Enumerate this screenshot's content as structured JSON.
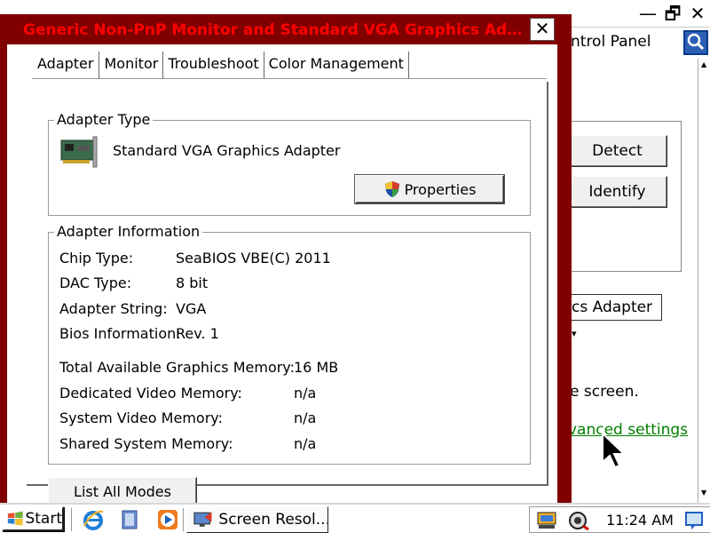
{
  "background_window": {
    "title_buttons": {
      "minimize": "—",
      "restore": "🗗",
      "close": "✕"
    },
    "control_panel_label": "ntrol Panel",
    "detect_button": "Detect",
    "identify_button": "Identify",
    "display_dropdown": "cs Adapter",
    "screen_text": "e screen.",
    "advanced_settings_link": "vanced settings"
  },
  "dialog": {
    "title": "Generic Non-PnP Monitor and Standard VGA Graphics Adapter Pro...",
    "close_label": "✕",
    "tabs": [
      {
        "label": "Adapter",
        "active": true
      },
      {
        "label": "Monitor",
        "active": false
      },
      {
        "label": "Troubleshoot",
        "active": false
      },
      {
        "label": "Color Management",
        "active": false
      }
    ],
    "adapter_type": {
      "legend": "Adapter Type",
      "name": "Standard VGA Graphics Adapter",
      "properties_button": "Properties"
    },
    "adapter_information": {
      "legend": "Adapter Information",
      "rows": [
        {
          "label": "Chip Type:",
          "value": "SeaBIOS VBE(C) 2011"
        },
        {
          "label": "DAC Type:",
          "value": "8 bit"
        },
        {
          "label": "Adapter String:",
          "value": "VGA"
        },
        {
          "label": "Bios Information:",
          "value": "Rev. 1"
        }
      ],
      "memory_rows": [
        {
          "label": "Total Available Graphics Memory:",
          "value": "16 MB"
        },
        {
          "label": "Dedicated Video Memory:",
          "value": "n/a"
        },
        {
          "label": "System Video Memory:",
          "value": "n/a"
        },
        {
          "label": "Shared System Memory:",
          "value": "n/a"
        }
      ]
    },
    "list_all_modes_button": "List All Modes"
  },
  "taskbar": {
    "start_label": "Start",
    "task_button_label": "Screen Resol...",
    "clock": "11:24 AM"
  },
  "colors": {
    "dialog_frame": "#800000",
    "title_text": "#ff0000",
    "link_green": "#008000"
  },
  "icons": [
    "windows-logo-icon",
    "internet-explorer-icon",
    "show-desktop-icon",
    "media-player-icon",
    "screen-resolution-icon",
    "network-icon",
    "volume-icon",
    "action-center-icon",
    "graphics-card-icon",
    "uac-shield-icon",
    "search-icon"
  ]
}
